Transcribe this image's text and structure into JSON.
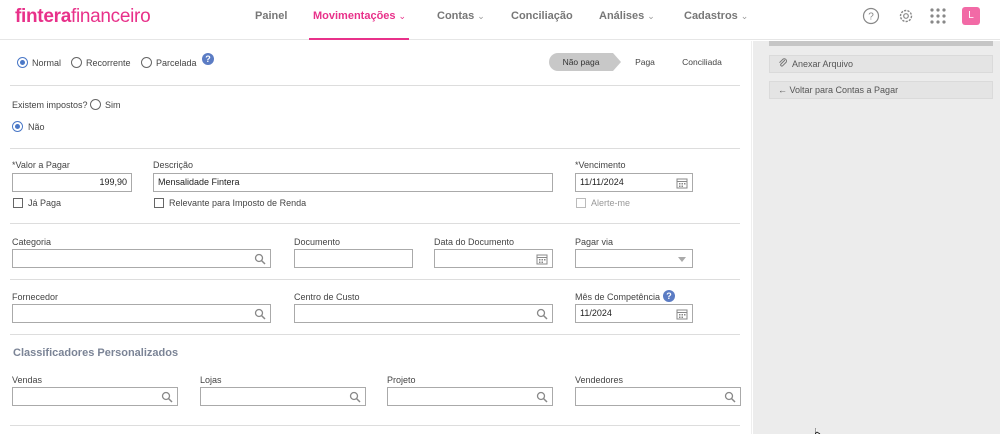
{
  "app": {
    "logo_bold": "fintera",
    "logo_light": "financeiro",
    "user_initial": "L",
    "brand_color": "#e8318a"
  },
  "nav": {
    "painel": "Painel",
    "movimentacoes": "Movimentações",
    "contas": "Contas",
    "conciliacao": "Conciliação",
    "analises": "Análises",
    "cadastros": "Cadastros"
  },
  "type_options": {
    "normal": "Normal",
    "recorrente": "Recorrente",
    "parcelada": "Parcelada",
    "selected": "Normal"
  },
  "status_steps": {
    "nao_paga": "Não paga",
    "paga": "Paga",
    "conciliada": "Conciliada",
    "current": "Não paga"
  },
  "impostos": {
    "question": "Existem impostos?",
    "sim": "Sim",
    "nao": "Não",
    "selected": "Não"
  },
  "fields": {
    "valor_label": "*Valor a Pagar",
    "valor_value": "199,90",
    "descricao_label": "Descrição",
    "descricao_value": "Mensalidade Fintera",
    "vencimento_label": "*Vencimento",
    "vencimento_value": "11/11/2024",
    "ja_paga_label": "Já Paga",
    "relevante_label": "Relevante para Imposto de Renda",
    "alerte_label": "Alerte-me",
    "categoria_label": "Categoria",
    "documento_label": "Documento",
    "data_documento_label": "Data do Documento",
    "pagar_via_label": "Pagar via",
    "fornecedor_label": "Fornecedor",
    "centro_custo_label": "Centro de Custo",
    "mes_competencia_label": "Mês de Competência",
    "mes_competencia_value": "11/2024"
  },
  "classificadores": {
    "title": "Classificadores Personalizados",
    "vendas": "Vendas",
    "lojas": "Lojas",
    "projeto": "Projeto",
    "vendedores": "Vendedores"
  },
  "sidebar": {
    "anexar": "Anexar Arquivo",
    "voltar": "← Voltar para Contas a Pagar"
  }
}
